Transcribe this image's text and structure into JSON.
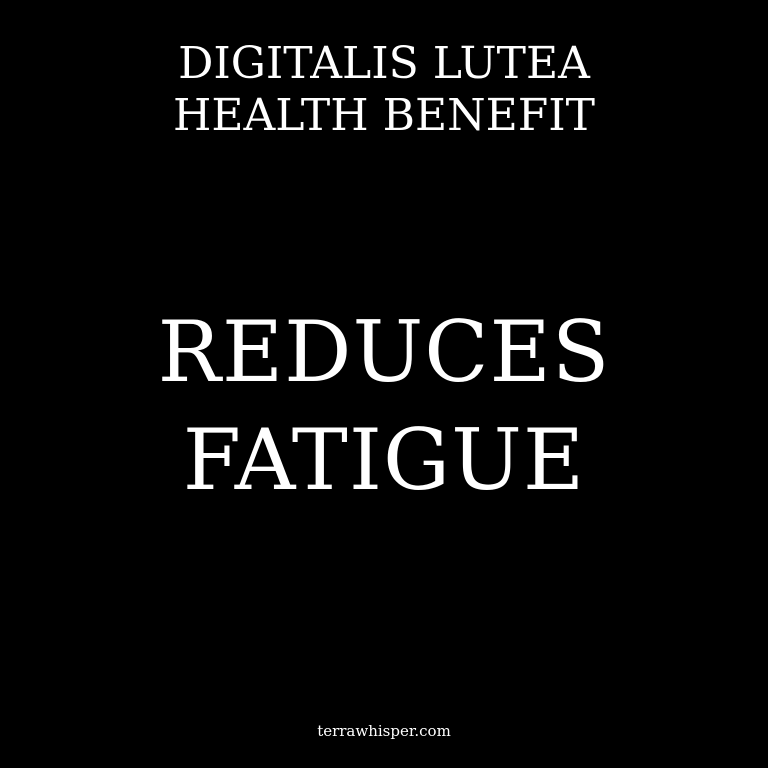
{
  "header": {
    "line1": "DIGITALIS LUTEA",
    "line2": "HEALTH BENEFIT"
  },
  "benefit": {
    "line1": "REDUCES",
    "line2": "FATIGUE"
  },
  "footer": {
    "site": "terrawhisper.com"
  },
  "colors": {
    "background": "#000000",
    "text": "#ffffff"
  }
}
